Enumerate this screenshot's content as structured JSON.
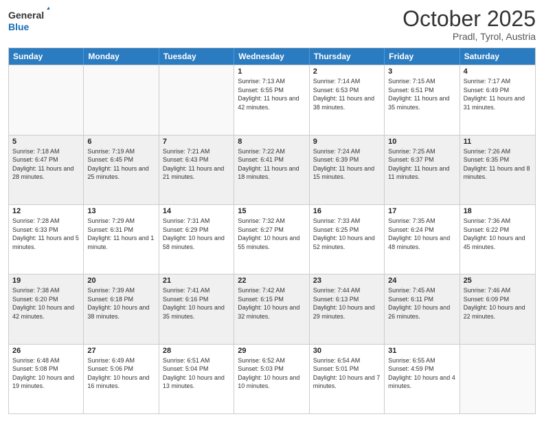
{
  "logo": {
    "line1": "General",
    "line2": "Blue"
  },
  "header": {
    "month": "October 2025",
    "location": "Pradl, Tyrol, Austria"
  },
  "weekdays": [
    "Sunday",
    "Monday",
    "Tuesday",
    "Wednesday",
    "Thursday",
    "Friday",
    "Saturday"
  ],
  "rows": [
    [
      {
        "day": "",
        "info": ""
      },
      {
        "day": "",
        "info": ""
      },
      {
        "day": "",
        "info": ""
      },
      {
        "day": "1",
        "info": "Sunrise: 7:13 AM\nSunset: 6:55 PM\nDaylight: 11 hours and 42 minutes."
      },
      {
        "day": "2",
        "info": "Sunrise: 7:14 AM\nSunset: 6:53 PM\nDaylight: 11 hours and 38 minutes."
      },
      {
        "day": "3",
        "info": "Sunrise: 7:15 AM\nSunset: 6:51 PM\nDaylight: 11 hours and 35 minutes."
      },
      {
        "day": "4",
        "info": "Sunrise: 7:17 AM\nSunset: 6:49 PM\nDaylight: 11 hours and 31 minutes."
      }
    ],
    [
      {
        "day": "5",
        "info": "Sunrise: 7:18 AM\nSunset: 6:47 PM\nDaylight: 11 hours and 28 minutes."
      },
      {
        "day": "6",
        "info": "Sunrise: 7:19 AM\nSunset: 6:45 PM\nDaylight: 11 hours and 25 minutes."
      },
      {
        "day": "7",
        "info": "Sunrise: 7:21 AM\nSunset: 6:43 PM\nDaylight: 11 hours and 21 minutes."
      },
      {
        "day": "8",
        "info": "Sunrise: 7:22 AM\nSunset: 6:41 PM\nDaylight: 11 hours and 18 minutes."
      },
      {
        "day": "9",
        "info": "Sunrise: 7:24 AM\nSunset: 6:39 PM\nDaylight: 11 hours and 15 minutes."
      },
      {
        "day": "10",
        "info": "Sunrise: 7:25 AM\nSunset: 6:37 PM\nDaylight: 11 hours and 11 minutes."
      },
      {
        "day": "11",
        "info": "Sunrise: 7:26 AM\nSunset: 6:35 PM\nDaylight: 11 hours and 8 minutes."
      }
    ],
    [
      {
        "day": "12",
        "info": "Sunrise: 7:28 AM\nSunset: 6:33 PM\nDaylight: 11 hours and 5 minutes."
      },
      {
        "day": "13",
        "info": "Sunrise: 7:29 AM\nSunset: 6:31 PM\nDaylight: 11 hours and 1 minute."
      },
      {
        "day": "14",
        "info": "Sunrise: 7:31 AM\nSunset: 6:29 PM\nDaylight: 10 hours and 58 minutes."
      },
      {
        "day": "15",
        "info": "Sunrise: 7:32 AM\nSunset: 6:27 PM\nDaylight: 10 hours and 55 minutes."
      },
      {
        "day": "16",
        "info": "Sunrise: 7:33 AM\nSunset: 6:25 PM\nDaylight: 10 hours and 52 minutes."
      },
      {
        "day": "17",
        "info": "Sunrise: 7:35 AM\nSunset: 6:24 PM\nDaylight: 10 hours and 48 minutes."
      },
      {
        "day": "18",
        "info": "Sunrise: 7:36 AM\nSunset: 6:22 PM\nDaylight: 10 hours and 45 minutes."
      }
    ],
    [
      {
        "day": "19",
        "info": "Sunrise: 7:38 AM\nSunset: 6:20 PM\nDaylight: 10 hours and 42 minutes."
      },
      {
        "day": "20",
        "info": "Sunrise: 7:39 AM\nSunset: 6:18 PM\nDaylight: 10 hours and 38 minutes."
      },
      {
        "day": "21",
        "info": "Sunrise: 7:41 AM\nSunset: 6:16 PM\nDaylight: 10 hours and 35 minutes."
      },
      {
        "day": "22",
        "info": "Sunrise: 7:42 AM\nSunset: 6:15 PM\nDaylight: 10 hours and 32 minutes."
      },
      {
        "day": "23",
        "info": "Sunrise: 7:44 AM\nSunset: 6:13 PM\nDaylight: 10 hours and 29 minutes."
      },
      {
        "day": "24",
        "info": "Sunrise: 7:45 AM\nSunset: 6:11 PM\nDaylight: 10 hours and 26 minutes."
      },
      {
        "day": "25",
        "info": "Sunrise: 7:46 AM\nSunset: 6:09 PM\nDaylight: 10 hours and 22 minutes."
      }
    ],
    [
      {
        "day": "26",
        "info": "Sunrise: 6:48 AM\nSunset: 5:08 PM\nDaylight: 10 hours and 19 minutes."
      },
      {
        "day": "27",
        "info": "Sunrise: 6:49 AM\nSunset: 5:06 PM\nDaylight: 10 hours and 16 minutes."
      },
      {
        "day": "28",
        "info": "Sunrise: 6:51 AM\nSunset: 5:04 PM\nDaylight: 10 hours and 13 minutes."
      },
      {
        "day": "29",
        "info": "Sunrise: 6:52 AM\nSunset: 5:03 PM\nDaylight: 10 hours and 10 minutes."
      },
      {
        "day": "30",
        "info": "Sunrise: 6:54 AM\nSunset: 5:01 PM\nDaylight: 10 hours and 7 minutes."
      },
      {
        "day": "31",
        "info": "Sunrise: 6:55 AM\nSunset: 4:59 PM\nDaylight: 10 hours and 4 minutes."
      },
      {
        "day": "",
        "info": ""
      }
    ]
  ]
}
